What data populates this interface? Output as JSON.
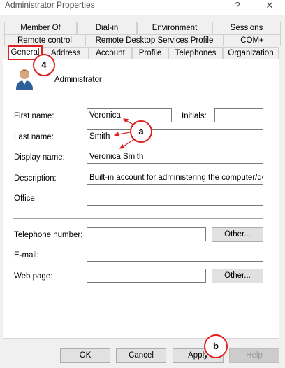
{
  "window": {
    "title": "Administrator Properties",
    "help_glyph": "?",
    "close_glyph": "✕"
  },
  "tabs": {
    "row1": [
      "Member Of",
      "Dial-in",
      "Environment",
      "Sessions"
    ],
    "row2": [
      "Remote control",
      "Remote Desktop Services Profile",
      "COM+"
    ],
    "row3": [
      "General",
      "Address",
      "Account",
      "Profile",
      "Telephones",
      "Organization"
    ],
    "active": "General"
  },
  "general": {
    "account_icon": "user-icon",
    "account_name": "Administrator",
    "first_name_label": "First name:",
    "first_name_value": "Veronica",
    "initials_label": "Initials:",
    "initials_value": "",
    "last_name_label": "Last name:",
    "last_name_value": "Smith",
    "display_name_label": "Display name:",
    "display_name_value": "Veronica Smith",
    "description_label": "Description:",
    "description_value": "Built-in account for administering the computer/domain",
    "office_label": "Office:",
    "office_value": "",
    "telephone_label": "Telephone number:",
    "telephone_value": "",
    "email_label": "E-mail:",
    "email_value": "",
    "webpage_label": "Web page:",
    "webpage_value": "",
    "other_label": "Other..."
  },
  "buttons": {
    "ok": "OK",
    "cancel": "Cancel",
    "apply": "Apply",
    "help": "Help"
  },
  "annotations": {
    "callout_4": "4",
    "callout_a": "a",
    "callout_b": "b",
    "accent_color": "#e02020"
  }
}
